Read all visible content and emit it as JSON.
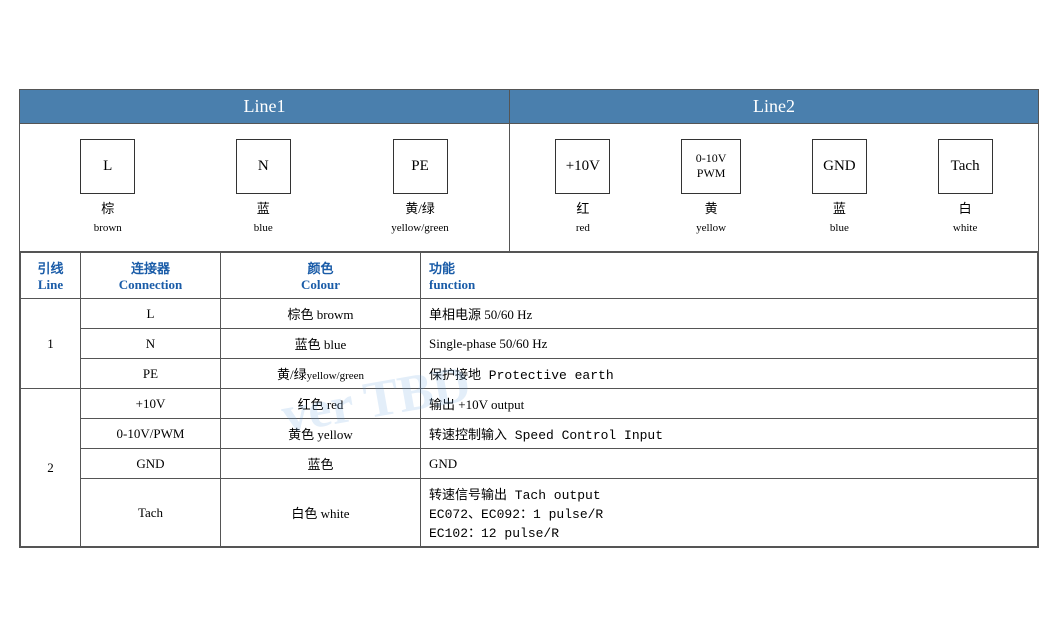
{
  "header": {
    "line1_label": "Line1",
    "line2_label": "Line2"
  },
  "line1_connectors": [
    {
      "symbol": "L",
      "chinese": "棕",
      "english": "brown"
    },
    {
      "symbol": "N",
      "chinese": "蓝",
      "english": "blue"
    },
    {
      "symbol": "PE",
      "chinese": "黄/绿",
      "english": "yellow/green"
    }
  ],
  "line2_connectors": [
    {
      "symbol": "+10V",
      "chinese": "红",
      "english": "red"
    },
    {
      "symbol": "0-10V\nPWM",
      "chinese": "黄",
      "english": "yellow"
    },
    {
      "symbol": "GND",
      "chinese": "蓝",
      "english": "blue"
    },
    {
      "symbol": "Tach",
      "chinese": "白",
      "english": "white"
    }
  ],
  "table_headers": {
    "line_zh": "引线",
    "line_en": "Line",
    "conn_zh": "连接器",
    "conn_en": "Connection",
    "colour_zh": "颜色",
    "colour_en": "Colour",
    "func_zh": "功能",
    "func_en": "function"
  },
  "rows": [
    {
      "line_num": "1",
      "rowspan": 3,
      "entries": [
        {
          "conn": "L",
          "colour_zh": "棕色",
          "colour_en": "browm",
          "func": "单相电源 50/60 Hz"
        },
        {
          "conn": "N",
          "colour_zh": "蓝色",
          "colour_en": "blue",
          "func": "Single-phase 50/60 Hz"
        },
        {
          "conn": "PE",
          "colour_zh": "黄/绿",
          "colour_en": "yellow/green",
          "func": "保护接地 Protective earth"
        }
      ]
    },
    {
      "line_num": "2",
      "rowspan": 4,
      "entries": [
        {
          "conn": "+10V",
          "colour_zh": "红色",
          "colour_en": "red",
          "func": "输出 +10V output"
        },
        {
          "conn": "0-10V/PWM",
          "colour_zh": "黄色",
          "colour_en": "yellow",
          "func": "转速控制输入 Speed Control Input"
        },
        {
          "conn": "GND",
          "colour_zh": "蓝色",
          "colour_en": "",
          "func": "GND"
        },
        {
          "conn": "Tach",
          "colour_zh": "白色",
          "colour_en": "white",
          "func_lines": [
            "转速信号输出 Tach output",
            "EC072、EC092：1 pulse/R",
            "EC102：12 pulse/R"
          ]
        }
      ]
    }
  ],
  "watermark_text": "ver TBD"
}
